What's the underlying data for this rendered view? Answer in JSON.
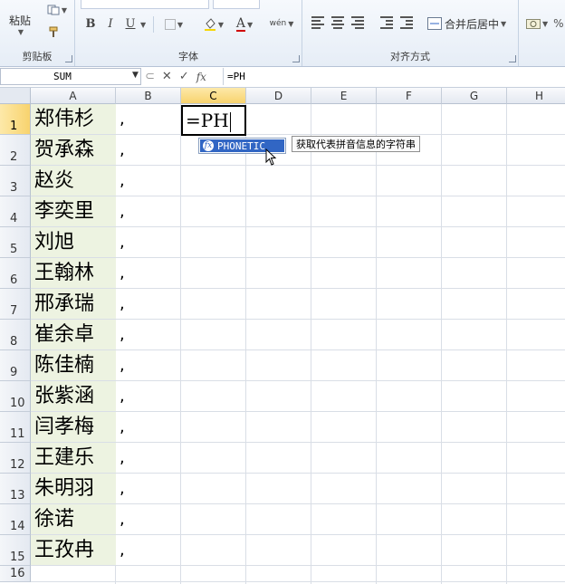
{
  "ribbon": {
    "clipboard": {
      "paste_label": "粘贴",
      "group_label": "剪贴板"
    },
    "font": {
      "group_label": "字体",
      "bold": "B",
      "italic": "I",
      "underline": "U",
      "font_color_glyph": "A",
      "phonetic_glyph": "wén"
    },
    "alignment": {
      "merge_label": "合并后居中",
      "group_label": "对齐方式"
    }
  },
  "formula_bar": {
    "name_box": "SUM",
    "cancel_glyph": "✕",
    "enter_glyph": "✓",
    "fx_glyph": "fx",
    "formula": "=PH"
  },
  "columns": [
    "A",
    "B",
    "C",
    "D",
    "E",
    "F",
    "G",
    "H"
  ],
  "rows": [
    "1",
    "2",
    "3",
    "4",
    "5",
    "6",
    "7",
    "8",
    "9",
    "10",
    "11",
    "12",
    "13",
    "14",
    "15",
    "16"
  ],
  "names": [
    "郑伟杉",
    "贺承森",
    "赵炎",
    "李奕里",
    "刘旭",
    "王翰林",
    "邢承瑞",
    "崔余卓",
    "陈佳楠",
    "张紫涵",
    "闫孝梅",
    "王建乐",
    "朱明羽",
    "徐诺",
    "王孜冉"
  ],
  "comma": ",",
  "active_cell": {
    "text": "=PH"
  },
  "autocomplete": {
    "fx_glyph": "fx",
    "item": "PHONETIC",
    "tooltip": "获取代表拼音信息的字符串"
  }
}
